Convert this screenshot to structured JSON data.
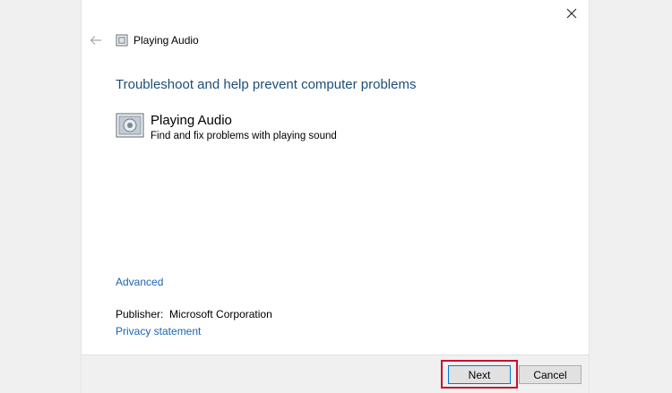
{
  "window": {
    "title": "Playing Audio",
    "close_icon": "close-icon",
    "back_icon": "back-arrow-icon",
    "app_icon": "troubleshooter-icon"
  },
  "main": {
    "heading": "Troubleshoot and help prevent computer problems",
    "item": {
      "icon": "audio-troubleshooter-icon",
      "title": "Playing Audio",
      "description": "Find and fix problems with playing sound"
    },
    "advanced_link": "Advanced",
    "publisher_label": "Publisher:",
    "publisher_value": "Microsoft Corporation",
    "privacy_link": "Privacy statement"
  },
  "footer": {
    "next_label": "Next",
    "cancel_label": "Cancel"
  },
  "colors": {
    "heading": "#1e4e79",
    "link": "#1a66b3",
    "highlight": "#c8102e",
    "focus_border": "#0078d7"
  }
}
